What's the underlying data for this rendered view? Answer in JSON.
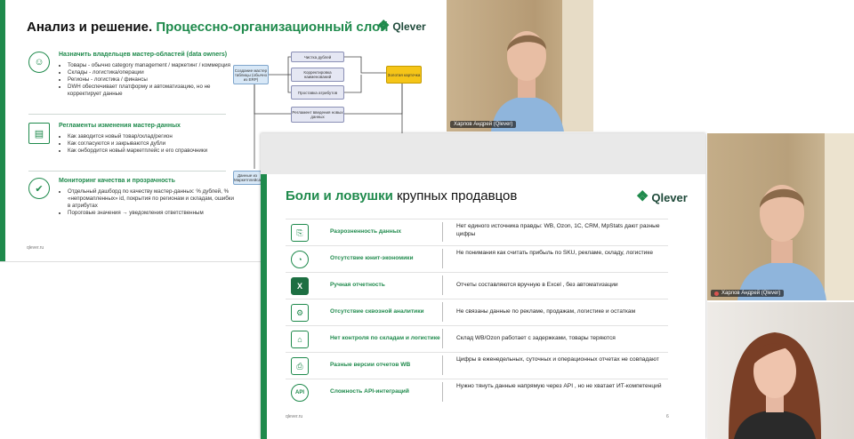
{
  "slide1": {
    "title_black": "Анализ и решение.",
    "title_green": "Процессно-организационный слой",
    "logo": "Qlever",
    "footer": "qlever.ru",
    "sections": [
      {
        "icon": "user-icon",
        "heading": "Назначить владельцев мастер-областей (data owners)",
        "items": [
          "Товары - обычно category management / маркетинг / коммерция",
          "Склады - логистика/операции",
          "Регионы - логистика / финансы",
          "DWH обеспечивает платформу и автоматизацию, но не корректирует данные"
        ]
      },
      {
        "icon": "document-icon",
        "heading": "Регламенты изменения мастер-данных",
        "items": [
          "Как заводится новый товар/склад/регион",
          "Как согласуются и закрываются дубли",
          "Как онбордится новый маркетплейс и его справочники"
        ]
      },
      {
        "icon": "thumbs-up-icon",
        "heading": "Мониторинг качества и прозрачность",
        "items": [
          "Отдельный дашборд по качеству мастер-данных: % дублей, % «непромапленных» id, покрытия по регионам и складам, ошибки в атрибутах",
          "Пороговые значения → уведомления ответственным"
        ]
      }
    ],
    "flow": {
      "source": "Создание мастер таблицы (обычно из ERP)",
      "steps": [
        "Чистка дублей",
        "Корректировка наименований",
        "Проставка атрибутов"
      ],
      "target": "Золотая карточка",
      "regulation": "Регламент введения новых данных",
      "bottom": "Данные из Маркетплейса"
    }
  },
  "slide2": {
    "title_green": "Боли и ловушки",
    "title_black": "крупных продавцов",
    "logo": "Qlever",
    "footer": "qlever.ru",
    "page": "6",
    "rows": [
      {
        "icon": "documents-icon",
        "label": "Разрозненность данных",
        "desc": "Нет единого источника правды: WB, Ozon, 1С, CRM, MpStats дают разные цифры"
      },
      {
        "icon": "pie-chart-icon",
        "label": "Отсутствие юнит-экономики",
        "desc": "Не понимания как считать прибыль по SKU, рекламе, складу, логистике"
      },
      {
        "icon": "excel-icon",
        "label": "Ручная отчетность",
        "desc": "Отчеты составляются вручную в Excel , без автоматизации"
      },
      {
        "icon": "analytics-icon",
        "label": "Отсутствие сквозной аналитики",
        "desc": "Не связаны данные по рекламе, продажам, логистике и остаткам"
      },
      {
        "icon": "warehouse-icon",
        "label": "Нет контроля по складам и логистике",
        "desc": "Склад WB/Ozon работает с задержками, товары теряются"
      },
      {
        "icon": "report-versions-icon",
        "label": "Разные версии отчетов WB",
        "desc": "Цифры в еженедельных, суточных и операционных отчетах не совпадают"
      },
      {
        "icon": "api-icon",
        "label": "Сложность API-интеграций",
        "desc": "Нужно тянуть данные напрямую через API , но не хватает ИТ-компетенций"
      }
    ]
  },
  "video": {
    "participant_1": "Харлов Андрей (Qlever)",
    "participant_2": "Харлов Андрей (Qlever)"
  }
}
